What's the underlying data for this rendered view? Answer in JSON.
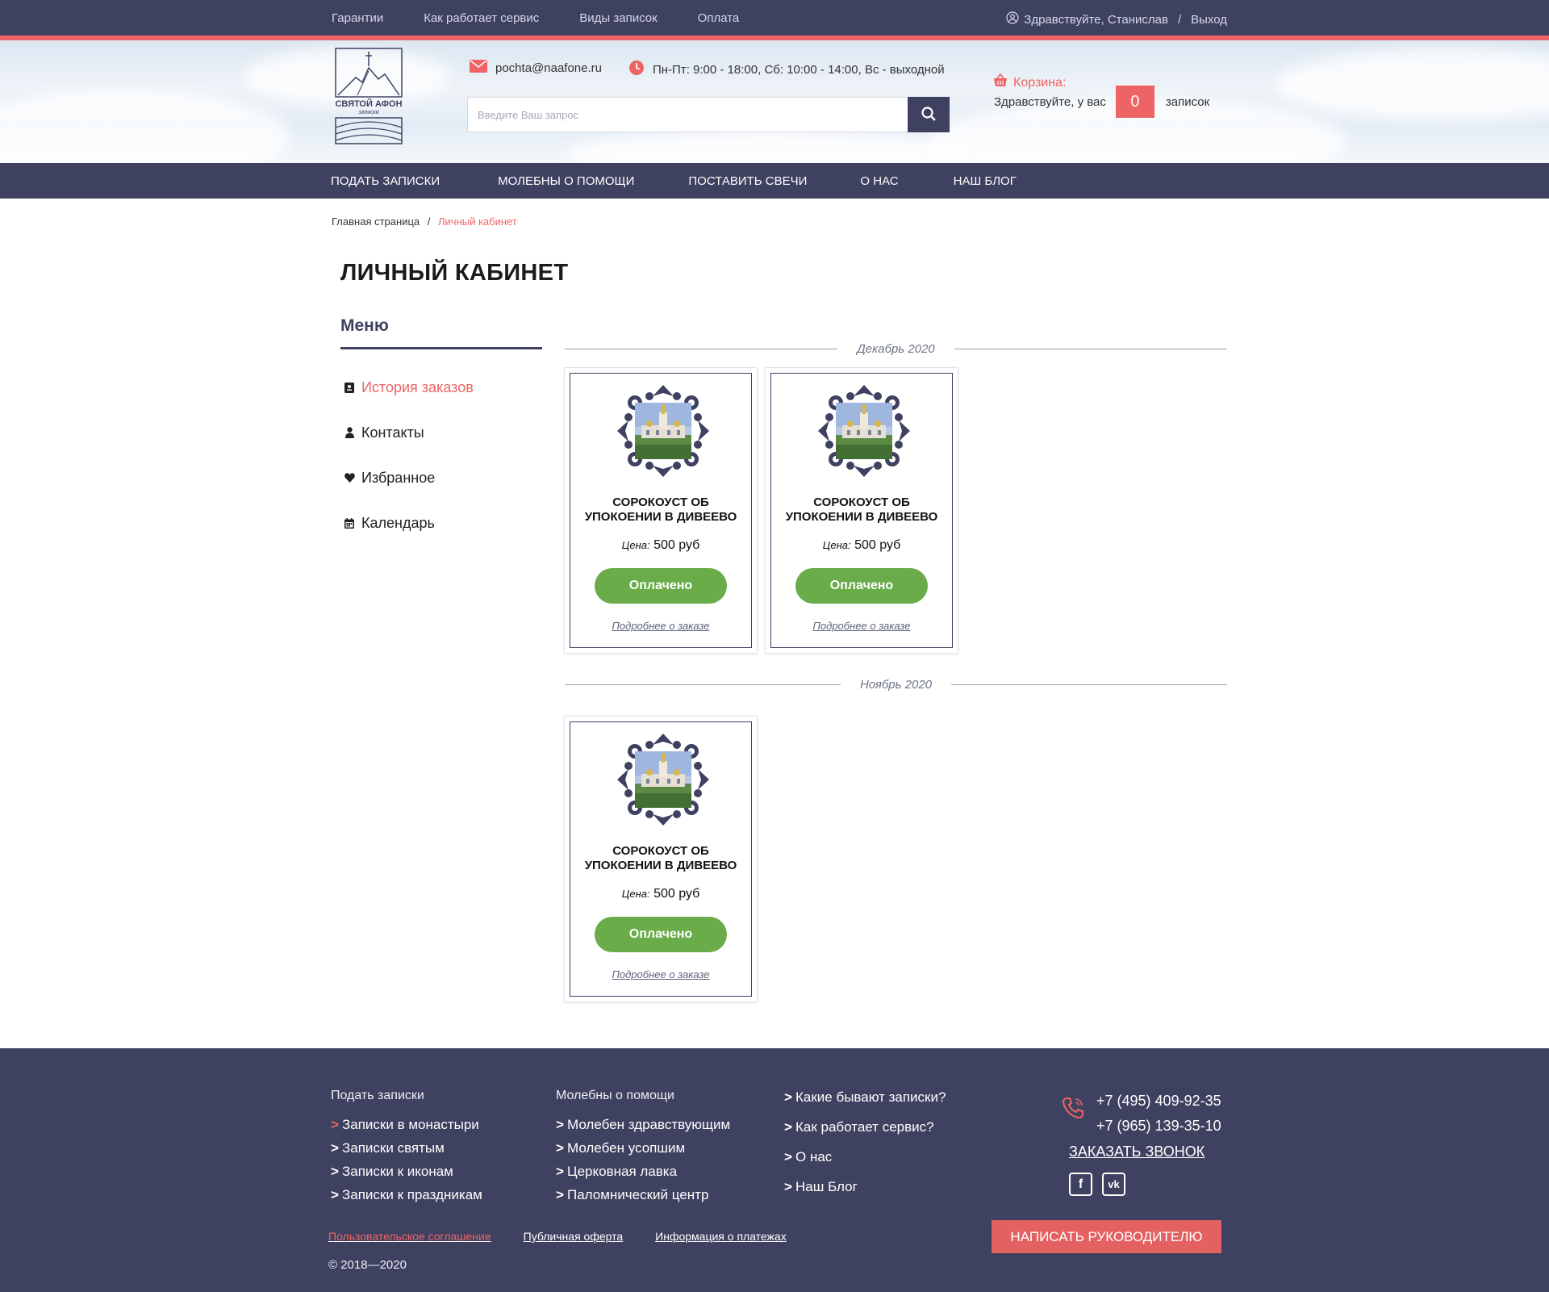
{
  "topbar": {
    "links": [
      "Гарантии",
      "Как работает сервис",
      "Виды записок",
      "Оплата"
    ],
    "greeting": "Здравствуйте, Станислав",
    "separator": "/",
    "logout": "Выход"
  },
  "header": {
    "logo_text": "СВЯТОЙ АФОН",
    "logo_subtext": "записки",
    "email": "pochta@naafone.ru",
    "hours": "Пн-Пт: 9:00 - 18:00, Сб: 10:00 - 14:00, Вс - выходной",
    "search_placeholder": "Введите Ваш запрос",
    "cart_title": "Корзина:",
    "cart_prefix": "Здравствуйте, у вас",
    "cart_count": "0",
    "cart_suffix": "записок"
  },
  "nav": [
    "ПОДАТЬ ЗАПИСКИ",
    "МОЛЕБНЫ О ПОМОЩИ",
    "ПОСТАВИТЬ СВЕЧИ",
    "О НАС",
    "НАШ БЛОГ"
  ],
  "breadcrumb": {
    "home": "Главная страница",
    "separator": "/",
    "current": "Личный кабинет"
  },
  "page_title": "ЛИЧНЫЙ КАБИНЕТ",
  "sidebar": {
    "title": "Меню",
    "items": [
      {
        "label": "История заказов",
        "icon": "order-history-icon",
        "active": true
      },
      {
        "label": "Контакты",
        "icon": "user-icon",
        "active": false
      },
      {
        "label": "Избранное",
        "icon": "heart-icon",
        "active": false
      },
      {
        "label": "Календарь",
        "icon": "calendar-icon",
        "active": false
      }
    ]
  },
  "orders": {
    "groups": [
      {
        "month": "Декабрь 2020",
        "items": [
          {
            "name_line1": "СОРОКОУСТ ОБ",
            "name_line2": "УПОКОЕНИИ В ДИВЕЕВО",
            "price_label": "Цена:",
            "price": "500 руб",
            "status": "Оплачено",
            "details": "Подробнее о заказе"
          },
          {
            "name_line1": "СОРОКОУСТ ОБ",
            "name_line2": "УПОКОЕНИИ В ДИВЕЕВО",
            "price_label": "Цена:",
            "price": "500 руб",
            "status": "Оплачено",
            "details": "Подробнее о заказе"
          }
        ]
      },
      {
        "month": "Ноябрь 2020",
        "items": [
          {
            "name_line1": "СОРОКОУСТ ОБ",
            "name_line2": "УПОКОЕНИИ В ДИВЕЕВО",
            "price_label": "Цена:",
            "price": "500 руб",
            "status": "Оплачено",
            "details": "Подробнее о заказе"
          }
        ]
      }
    ]
  },
  "footer": {
    "col1": {
      "head": "Подать записки",
      "items": [
        "Записки в монастыри",
        "Записки святым",
        "Записки к иконам",
        "Записки к праздникам"
      ]
    },
    "col2": {
      "head": "Молебны о помощи",
      "items": [
        "Молебен здравствующим",
        "Молебен усопшим",
        "Церковная лавка",
        "Паломнический центр"
      ]
    },
    "col3": {
      "items": [
        "Какие бывают записки?",
        "Как работает сервис?",
        "О нас",
        "Наш Блог"
      ]
    },
    "phones": [
      "+7 (495) 409-92-35",
      "+7 (965) 139-35-10"
    ],
    "callback": "ЗАКАЗАТЬ ЗВОНОК",
    "social": [
      {
        "icon": "facebook-icon",
        "glyph": "f"
      },
      {
        "icon": "vk-icon",
        "glyph": "vk"
      }
    ],
    "write_button": "НАПИСАТЬ РУКОВОДИТЕЛЮ",
    "links": [
      "Пользовательское соглашение",
      "Публичная оферта",
      "Информация о платежах"
    ],
    "copyright": "© 2018—2020"
  },
  "colors": {
    "primary": "#3e4160",
    "accent": "#ee6464",
    "paid": "#6aac4a"
  }
}
